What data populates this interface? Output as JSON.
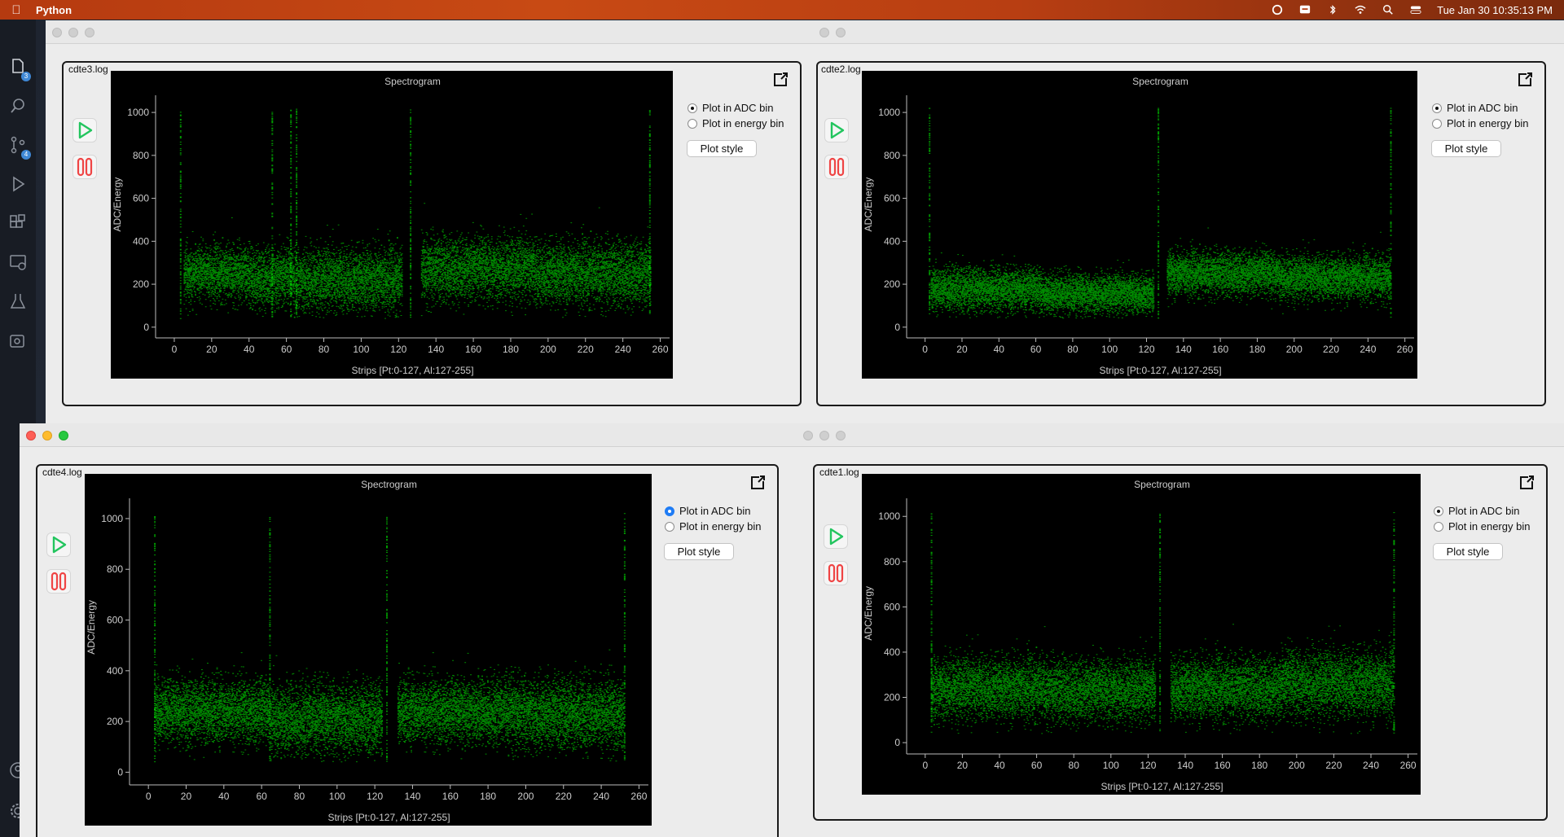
{
  "menubar": {
    "app_name": "Python",
    "clock": "Tue Jan 30  10:35:13 PM"
  },
  "activity_bar": {
    "explorer_badge": "3",
    "scm_badge": "4"
  },
  "windows": [
    {
      "id": "cdte3",
      "title": "cdte3.log",
      "chart_title": "Spectrogram",
      "radio_adc": "Plot in ADC bin",
      "radio_energy": "Plot in energy bin",
      "plot_style": "Plot style",
      "selected": "adc"
    },
    {
      "id": "cdte2",
      "title": "cdte2.log",
      "chart_title": "Spectrogram",
      "radio_adc": "Plot in ADC bin",
      "radio_energy": "Plot in energy bin",
      "plot_style": "Plot style",
      "selected": "adc"
    },
    {
      "id": "cdte4",
      "title": "cdte4.log",
      "chart_title": "Spectrogram",
      "radio_adc": "Plot in ADC bin",
      "radio_energy": "Plot in energy bin",
      "plot_style": "Plot style",
      "selected": "adc"
    },
    {
      "id": "cdte1",
      "title": "cdte1.log",
      "chart_title": "Spectrogram",
      "radio_adc": "Plot in ADC bin",
      "radio_energy": "Plot in energy bin",
      "plot_style": "Plot style",
      "selected": "adc"
    }
  ],
  "chart_data": [
    {
      "type": "heatmap",
      "title": "Spectrogram",
      "xlabel": "Strips [Pt:0-127, Al:127-255]",
      "ylabel": "ADC/Energy",
      "xticks": [
        0,
        20,
        40,
        60,
        80,
        100,
        120,
        140,
        160,
        180,
        200,
        220,
        240,
        260
      ],
      "yticks": [
        0,
        200,
        400,
        600,
        800,
        1000
      ],
      "xlim": [
        -10,
        265
      ],
      "ylim": [
        -50,
        1080
      ],
      "color": "#00ff00",
      "band_segments": [
        {
          "x": [
            5,
            40
          ],
          "center": 250,
          "spread": 110
        },
        {
          "x": [
            40,
            64
          ],
          "center": 230,
          "spread": 120
        },
        {
          "x": [
            64,
            122
          ],
          "center": 220,
          "spread": 130
        },
        {
          "x": [
            132,
            192
          ],
          "center": 270,
          "spread": 130
        },
        {
          "x": [
            192,
            255
          ],
          "center": 250,
          "spread": 130
        }
      ],
      "hot_strips": [
        3,
        52,
        62,
        65,
        126,
        254
      ]
    },
    {
      "type": "heatmap",
      "title": "Spectrogram",
      "xlabel": "Strips [Pt:0-127, Al:127-255]",
      "ylabel": "ADC/Energy",
      "xticks": [
        0,
        20,
        40,
        60,
        80,
        100,
        120,
        140,
        160,
        180,
        200,
        220,
        240,
        260
      ],
      "yticks": [
        0,
        200,
        400,
        600,
        800,
        1000
      ],
      "xlim": [
        -10,
        265
      ],
      "ylim": [
        -50,
        1080
      ],
      "color": "#00ff00",
      "band_segments": [
        {
          "x": [
            3,
            63
          ],
          "center": 175,
          "spread": 90
        },
        {
          "x": [
            63,
            124
          ],
          "center": 155,
          "spread": 80
        },
        {
          "x": [
            131,
            192
          ],
          "center": 250,
          "spread": 90
        },
        {
          "x": [
            192,
            252
          ],
          "center": 230,
          "spread": 90
        }
      ],
      "hot_strips": [
        2,
        126,
        252
      ]
    },
    {
      "type": "heatmap",
      "title": "Spectrogram",
      "xlabel": "Strips [Pt:0-127, Al:127-255]",
      "ylabel": "ADC/Energy",
      "xticks": [
        0,
        20,
        40,
        60,
        80,
        100,
        120,
        140,
        160,
        180,
        200,
        220,
        240,
        260
      ],
      "yticks": [
        0,
        200,
        400,
        600,
        800,
        1000
      ],
      "xlim": [
        -10,
        265
      ],
      "ylim": [
        -50,
        1080
      ],
      "color": "#00ff00",
      "band_segments": [
        {
          "x": [
            3,
            64
          ],
          "center": 240,
          "spread": 110
        },
        {
          "x": [
            64,
            124
          ],
          "center": 210,
          "spread": 120
        },
        {
          "x": [
            132,
            192
          ],
          "center": 240,
          "spread": 110
        },
        {
          "x": [
            192,
            252
          ],
          "center": 230,
          "spread": 120
        }
      ],
      "hot_strips": [
        3,
        64,
        126,
        252
      ]
    },
    {
      "type": "heatmap",
      "title": "Spectrogram",
      "xlabel": "Strips [Pt:0-127, Al:127-255]",
      "ylabel": "ADC/Energy",
      "xticks": [
        0,
        20,
        40,
        60,
        80,
        100,
        120,
        140,
        160,
        180,
        200,
        220,
        240,
        260
      ],
      "yticks": [
        0,
        200,
        400,
        600,
        800,
        1000
      ],
      "xlim": [
        -10,
        265
      ],
      "ylim": [
        -50,
        1080
      ],
      "color": "#00ff00",
      "band_segments": [
        {
          "x": [
            3,
            64
          ],
          "center": 240,
          "spread": 120
        },
        {
          "x": [
            64,
            124
          ],
          "center": 230,
          "spread": 120
        },
        {
          "x": [
            132,
            192
          ],
          "center": 240,
          "spread": 120
        },
        {
          "x": [
            192,
            252
          ],
          "center": 260,
          "spread": 130
        }
      ],
      "hot_strips": [
        3,
        126,
        252
      ]
    }
  ]
}
